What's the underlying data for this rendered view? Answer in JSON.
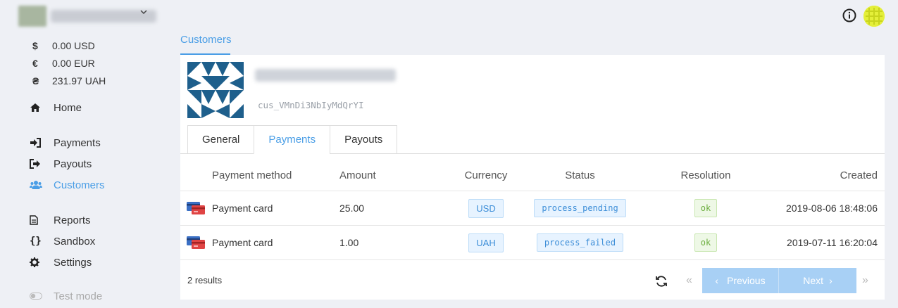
{
  "account": {
    "name": "",
    "caret_icon": "chevron-down-icon"
  },
  "balances": [
    {
      "symbol": "$",
      "amount": "0.00 USD"
    },
    {
      "symbol": "€",
      "amount": "0.00 EUR"
    },
    {
      "symbol": "₴",
      "amount": "231.97 UAH"
    }
  ],
  "nav": {
    "home": "Home",
    "payments": "Payments",
    "payouts": "Payouts",
    "customers": "Customers",
    "reports": "Reports",
    "sandbox": "Sandbox",
    "settings": "Settings",
    "test_mode": "Test mode"
  },
  "breadcrumb": {
    "label": "Customers"
  },
  "customer": {
    "id": "cus_VMnDi3NbIyMdQrYI"
  },
  "tabs": [
    "General",
    "Payments",
    "Payouts"
  ],
  "active_tab": "Payments",
  "table": {
    "headers": [
      "Payment method",
      "Amount",
      "Currency",
      "Status",
      "Resolution",
      "Created"
    ],
    "rows": [
      {
        "method": "Payment card",
        "amount": "25.00",
        "currency": "USD",
        "status": "process_pending",
        "resolution": "ok",
        "created": "2019-08-06 18:48:06"
      },
      {
        "method": "Payment card",
        "amount": "1.00",
        "currency": "UAH",
        "status": "process_failed",
        "resolution": "ok",
        "created": "2019-07-11 16:20:04"
      }
    ]
  },
  "footer": {
    "results": "2 results",
    "previous": "Previous",
    "next": "Next"
  },
  "colors": {
    "accent": "#4a9ee6",
    "background": "#eef0f5",
    "pager": "#a8d0f5"
  }
}
